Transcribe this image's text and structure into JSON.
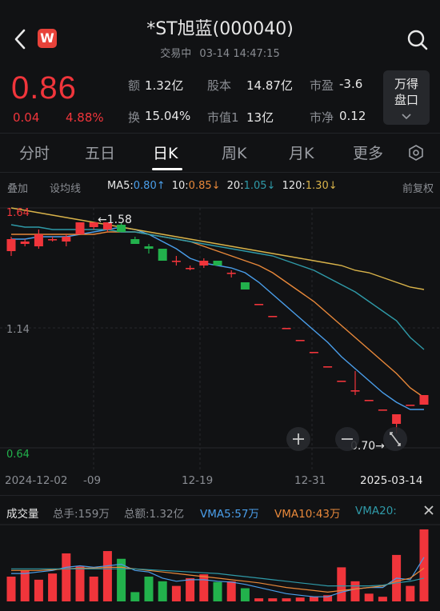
{
  "header": {
    "title": "*ST旭蓝(000040)",
    "status": "交易中",
    "datetime": "03-14 14:47:15",
    "badge": "W"
  },
  "quote": {
    "price": "0.86",
    "change": "0.04",
    "change_pct": "4.88%",
    "rows": [
      [
        {
          "label": "额",
          "value": "1.32亿"
        },
        {
          "label": "股本",
          "value": "14.87亿"
        },
        {
          "label": "市盈",
          "value": "-3.6"
        }
      ],
      [
        {
          "label": "换",
          "value": "15.04%"
        },
        {
          "label": "市值1",
          "value": "13亿"
        },
        {
          "label": "市净",
          "value": "0.12"
        }
      ]
    ],
    "unit_button": [
      "万得",
      "盘口"
    ]
  },
  "tabs": [
    "分时",
    "五日",
    "日K",
    "周K",
    "月K",
    "更多"
  ],
  "active_tab": "日K",
  "ma_bar": {
    "add": "叠加",
    "set": "设均线",
    "ma5_label": "MA5:",
    "ma5": "0.80↑",
    "ma10_label": "10:",
    "ma10": "0.85↓",
    "ma20_label": "20:",
    "ma20": "1.05↓",
    "ma120_label": "120:",
    "ma120": "1.30↓",
    "adjust": "前复权"
  },
  "chart_labels": {
    "y_top": "1.64",
    "y_mid": "1.14",
    "y_bottom": "0.64",
    "high_mark": "←1.58",
    "low_mark": "0.70→",
    "x_ticks": [
      "2024-12-02",
      "-09",
      "12-19",
      "12-31",
      "2025-03-14"
    ]
  },
  "volume": {
    "title": "成交量",
    "total_hands": "总手:159万",
    "amount": "总额:1.32亿",
    "vma5": "VMA5:57万",
    "vma10": "VMA10:43万",
    "vma20": "VMA20:"
  },
  "colors": {
    "up": "#f0353b",
    "down": "#22b14c",
    "ma5": "#4a9eea",
    "ma10": "#e8883a",
    "ma20": "#2f9aa8",
    "ma120": "#d9b34a"
  },
  "chart_data": {
    "type": "candlestick",
    "x": [
      "2024-12-02",
      "2024-12-03",
      "2024-12-04",
      "2024-12-05",
      "2024-12-06",
      "2024-12-09",
      "2024-12-10",
      "2024-12-11",
      "2024-12-12",
      "2024-12-13",
      "2024-12-16",
      "2024-12-17",
      "2024-12-18",
      "2024-12-19",
      "2024-12-20",
      "2024-12-23",
      "2024-12-24",
      "2024-12-25",
      "2024-12-26",
      "2024-12-27",
      "2024-12-30",
      "2024-12-31",
      "2025-01-02",
      "2025-01-03",
      "2025-01-06",
      "2025-01-07",
      "2025-03-10",
      "2025-03-11",
      "2025-03-12",
      "2025-03-13",
      "2025-03-14"
    ],
    "candles": [
      {
        "o": 1.46,
        "c": 1.51,
        "h": 1.52,
        "l": 1.44
      },
      {
        "o": 1.49,
        "c": 1.5,
        "h": 1.51,
        "l": 1.48
      },
      {
        "o": 1.48,
        "c": 1.53,
        "h": 1.55,
        "l": 1.47
      },
      {
        "o": 1.51,
        "c": 1.51,
        "h": 1.52,
        "l": 1.5
      },
      {
        "o": 1.5,
        "c": 1.52,
        "h": 1.53,
        "l": 1.48
      },
      {
        "o": 1.53,
        "c": 1.58,
        "h": 1.58,
        "l": 1.53
      },
      {
        "o": 1.56,
        "c": 1.58,
        "h": 1.58,
        "l": 1.55
      },
      {
        "o": 1.55,
        "c": 1.58,
        "h": 1.58,
        "l": 1.54
      },
      {
        "o": 1.57,
        "c": 1.54,
        "h": 1.58,
        "l": 1.54
      },
      {
        "o": 1.51,
        "c": 1.49,
        "h": 1.52,
        "l": 1.49
      },
      {
        "o": 1.48,
        "c": 1.47,
        "h": 1.49,
        "l": 1.45
      },
      {
        "o": 1.47,
        "c": 1.42,
        "h": 1.47,
        "l": 1.42
      },
      {
        "o": 1.42,
        "c": 1.42,
        "h": 1.44,
        "l": 1.4
      },
      {
        "o": 1.39,
        "c": 1.39,
        "h": 1.4,
        "l": 1.38
      },
      {
        "o": 1.4,
        "c": 1.42,
        "h": 1.43,
        "l": 1.39
      },
      {
        "o": 1.42,
        "c": 1.4,
        "h": 1.42,
        "l": 1.4
      },
      {
        "o": 1.37,
        "c": 1.37,
        "h": 1.38,
        "l": 1.35
      },
      {
        "o": 1.33,
        "c": 1.3,
        "h": 1.33,
        "l": 1.3
      },
      {
        "o": 1.24,
        "c": 1.24,
        "h": 1.24,
        "l": 1.24
      },
      {
        "o": 1.19,
        "c": 1.19,
        "h": 1.19,
        "l": 1.19
      },
      {
        "o": 1.14,
        "c": 1.14,
        "h": 1.14,
        "l": 1.14
      },
      {
        "o": 1.09,
        "c": 1.09,
        "h": 1.09,
        "l": 1.09
      },
      {
        "o": 1.04,
        "c": 1.04,
        "h": 1.04,
        "l": 1.04
      },
      {
        "o": 0.98,
        "c": 0.98,
        "h": 0.98,
        "l": 0.98
      },
      {
        "o": 0.92,
        "c": 0.92,
        "h": 0.92,
        "l": 0.92
      },
      {
        "o": 0.88,
        "c": 0.88,
        "h": 0.96,
        "l": 0.86
      },
      {
        "o": 0.84,
        "c": 0.84,
        "h": 0.84,
        "l": 0.84
      },
      {
        "o": 0.8,
        "c": 0.8,
        "h": 0.8,
        "l": 0.8
      },
      {
        "o": 0.74,
        "c": 0.78,
        "h": 0.78,
        "l": 0.7
      },
      {
        "o": 0.82,
        "c": 0.82,
        "h": 0.82,
        "l": 0.82
      },
      {
        "o": 0.82,
        "c": 0.86,
        "h": 0.86,
        "l": 0.82
      }
    ],
    "ma_lines": {
      "MA5": [
        1.51,
        1.51,
        1.52,
        1.52,
        1.52,
        1.53,
        1.54,
        1.55,
        1.56,
        1.55,
        1.53,
        1.5,
        1.47,
        1.43,
        1.41,
        1.4,
        1.39,
        1.37,
        1.33,
        1.28,
        1.23,
        1.18,
        1.13,
        1.08,
        1.02,
        0.97,
        0.92,
        0.87,
        0.83,
        0.8,
        0.8
      ],
      "MA10": [
        1.53,
        1.53,
        1.53,
        1.53,
        1.53,
        1.53,
        1.53,
        1.54,
        1.54,
        1.54,
        1.53,
        1.52,
        1.51,
        1.5,
        1.48,
        1.46,
        1.44,
        1.42,
        1.4,
        1.37,
        1.33,
        1.29,
        1.25,
        1.2,
        1.15,
        1.1,
        1.05,
        1.0,
        0.95,
        0.89,
        0.85
      ],
      "MA20": [
        1.57,
        1.56,
        1.56,
        1.55,
        1.55,
        1.55,
        1.55,
        1.55,
        1.54,
        1.54,
        1.53,
        1.52,
        1.51,
        1.5,
        1.49,
        1.48,
        1.47,
        1.46,
        1.45,
        1.44,
        1.42,
        1.4,
        1.38,
        1.35,
        1.32,
        1.29,
        1.25,
        1.21,
        1.17,
        1.1,
        1.05
      ],
      "MA120": [
        1.64,
        1.63,
        1.62,
        1.61,
        1.6,
        1.59,
        1.58,
        1.57,
        1.56,
        1.55,
        1.54,
        1.53,
        1.52,
        1.51,
        1.5,
        1.49,
        1.48,
        1.47,
        1.46,
        1.45,
        1.44,
        1.43,
        1.42,
        1.41,
        1.4,
        1.38,
        1.37,
        1.35,
        1.33,
        1.31,
        1.3
      ]
    },
    "ylim": [
      0.64,
      1.64
    ],
    "volume": [
      32,
      40,
      28,
      36,
      62,
      45,
      32,
      65,
      55,
      12,
      32,
      26,
      20,
      30,
      35,
      25,
      26,
      17,
      4,
      4,
      4,
      5,
      6,
      8,
      44,
      26,
      10,
      6,
      60,
      20,
      93
    ],
    "vma_lines": {
      "VMA5": [
        36,
        36,
        38,
        40,
        44,
        46,
        44,
        46,
        48,
        40,
        38,
        30,
        26,
        28,
        28,
        26,
        25,
        22,
        18,
        14,
        10,
        8,
        6,
        6,
        12,
        16,
        18,
        18,
        30,
        28,
        57
      ],
      "VMA10": [
        40,
        40,
        40,
        41,
        42,
        43,
        43,
        44,
        44,
        42,
        40,
        38,
        36,
        34,
        32,
        30,
        28,
        26,
        24,
        21,
        18,
        16,
        14,
        12,
        14,
        16,
        18,
        20,
        26,
        30,
        43
      ],
      "VMA20": [
        42,
        42,
        42,
        42,
        42,
        42,
        42,
        42,
        42,
        42,
        41,
        40,
        39,
        38,
        37,
        36,
        34,
        32,
        30,
        28,
        26,
        24,
        22,
        20,
        20,
        20,
        20,
        21,
        24,
        26,
        30
      ]
    }
  }
}
